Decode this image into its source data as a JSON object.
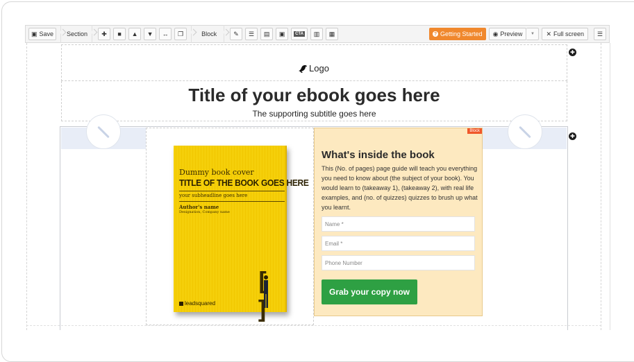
{
  "toolbar": {
    "save_label": "Save",
    "section_label": "Section",
    "block_label": "Block",
    "getting_started_label": "Getting Started",
    "preview_label": "Preview",
    "fullscreen_label": "Full screen"
  },
  "page": {
    "logo_text": "Logo",
    "title": "Title of your ebook goes here",
    "subtitle": "The supporting subtitle goes here"
  },
  "book_cover": {
    "small_heading": "Dummy book cover",
    "title": "TITLE OF THE BOOK GOES HERE",
    "subheadline": "your subheadline goes here",
    "author": "Author's name",
    "designation": "Designation, Company name",
    "brand": "leadsquared"
  },
  "form": {
    "block_tag": "Block",
    "heading": "What's inside the book",
    "body": "This (No. of pages) page guide will teach you everything you need to know about (the subject of your book). You would learn to (takeaway 1), (takeaway 2), with real life examples, and (no. of quizzes) quizzes to brush up what you learnt.",
    "name_placeholder": "Name *",
    "email_placeholder": "Email *",
    "phone_placeholder": "Phone Number",
    "submit_label": "Grab your copy now"
  },
  "colors": {
    "accent_orange": "#f0882d",
    "cta_green": "#2ea043",
    "form_bg": "#fde9c0",
    "book_yellow": "#f5cf0a"
  }
}
